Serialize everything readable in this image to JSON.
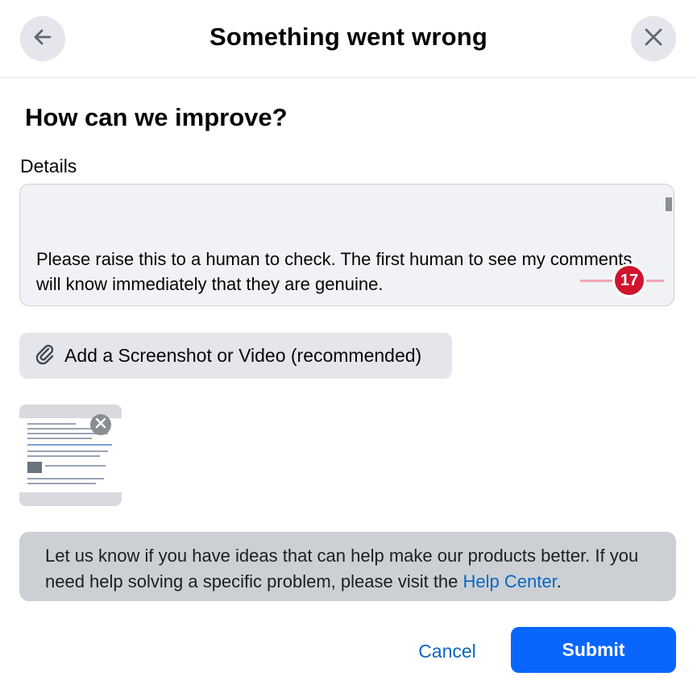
{
  "header": {
    "title": "Something went wrong",
    "back_icon": "arrow-left-icon",
    "close_icon": "close-icon"
  },
  "form": {
    "section_title": "How can we improve?",
    "details_label": "Details",
    "details_value": "\nPlease raise this to a human to check. The first human to see my comments  will know immediately that they are genuine.\n\nThis is what I want",
    "grammar_issue_count": "17",
    "attach_label": "Add a Screenshot or Video (recommended)",
    "attach_icon": "paperclip-icon",
    "remove_icon": "close-icon"
  },
  "info": {
    "text_before_link": "Let us know if you have ideas that can help make our products better. If you need help solving a specific problem, please visit the ",
    "link_text": "Help Center",
    "text_after_link": "."
  },
  "actions": {
    "cancel_label": "Cancel",
    "submit_label": "Submit"
  },
  "colors": {
    "primary": "#0866ff",
    "link": "#0a66c2",
    "badge": "#d0142e"
  }
}
